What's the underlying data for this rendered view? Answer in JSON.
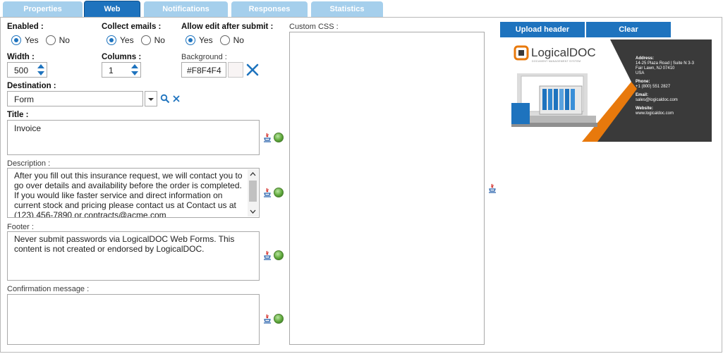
{
  "tabs": [
    {
      "label": "Properties",
      "active": false
    },
    {
      "label": "Web",
      "active": true
    },
    {
      "label": "Notifications",
      "active": false
    },
    {
      "label": "Responses",
      "active": false
    },
    {
      "label": "Statistics",
      "active": false
    }
  ],
  "enabled": {
    "label": "Enabled :",
    "yes": "Yes",
    "no": "No",
    "value": "Yes"
  },
  "collect_emails": {
    "label": "Collect emails :",
    "yes": "Yes",
    "no": "No",
    "value": "Yes"
  },
  "allow_edit": {
    "label": "Allow edit after submit :",
    "yes": "Yes",
    "no": "No",
    "value": "Yes"
  },
  "width": {
    "label": "Width :",
    "value": "500"
  },
  "columns": {
    "label": "Columns :",
    "value": "1"
  },
  "background": {
    "label": "Background :",
    "value": "#F8F4F4",
    "display": "#F8F4F4"
  },
  "destination": {
    "label": "Destination :",
    "value": "Form"
  },
  "title": {
    "label": "Title :",
    "value": "Invoice"
  },
  "description": {
    "label": "Description :",
    "value": "After you fill out this insurance request, we will contact you to go over details and availability before the order is completed. If you would like faster service and direct information on current stock and pricing please contact us at Contact us at (123) 456-7890 or contracts@acme.com"
  },
  "footer": {
    "label": "Footer :",
    "value": "Never submit passwords via LogicalDOC Web Forms. This content is not created or endorsed by LogicalDOC."
  },
  "confirmation": {
    "label": "Confirmation message :",
    "value": ""
  },
  "custom_css": {
    "label": "Custom CSS :",
    "value": ""
  },
  "buttons": {
    "upload_header": "Upload header",
    "clear": "Clear"
  },
  "header_image": {
    "brand": "LogicalDOC",
    "tagline": "DOCUMENT MANAGEMENT SYSTEM",
    "address_label": "Address:",
    "address_1": "14-25 Plaza Road | Suite N 3-3",
    "address_2": "Fair Lawn, NJ 07410",
    "address_3": "USA",
    "phone_label": "Phone:",
    "phone": "+1 (800) 551 2827",
    "email_label": "Email:",
    "email": "sales@logicaldoc.com",
    "website_label": "Website:",
    "website": "www.logicaldoc.com"
  },
  "colors": {
    "accent": "#1e73be",
    "tab_inactive": "#a5cfec",
    "brand_orange": "#e8790c",
    "brand_dark": "#3a3a3a"
  }
}
